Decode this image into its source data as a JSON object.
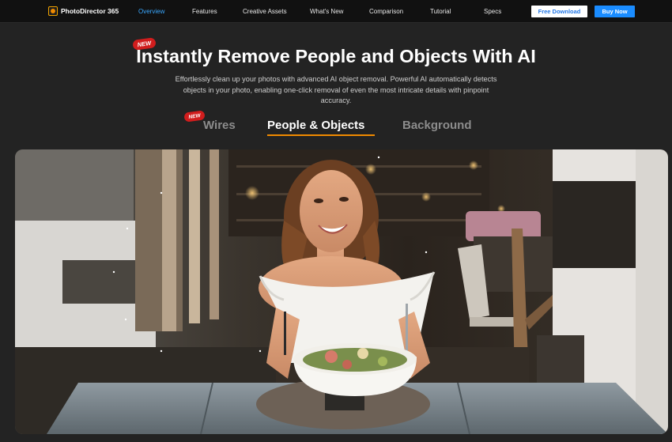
{
  "nav": {
    "brand": "PhotoDirector 365",
    "links": [
      {
        "label": "Overview",
        "active": true
      },
      {
        "label": "Features",
        "active": false
      },
      {
        "label": "Creative Assets",
        "active": false
      },
      {
        "label": "What's New",
        "active": false
      },
      {
        "label": "Comparison",
        "active": false
      },
      {
        "label": "Tutorial",
        "active": false
      },
      {
        "label": "Specs",
        "active": false
      }
    ],
    "free_download": "Free Download",
    "buy_now": "Buy Now"
  },
  "hero": {
    "badge": "NEW",
    "title": "Instantly Remove People and Objects With AI",
    "description": "Effortlessly clean up your photos with advanced AI object removal. Powerful AI automatically detects objects in your photo, enabling one-click removal of even the most intricate details with pinpoint accuracy."
  },
  "tabs": {
    "badge": "NEW",
    "items": [
      {
        "label": "Wires",
        "active": false
      },
      {
        "label": "People & Objects",
        "active": true
      },
      {
        "label": "Background",
        "active": false
      }
    ]
  },
  "colors": {
    "accent": "#f08a00",
    "nav_active": "#3aa8ff",
    "buy_button": "#1a8cff",
    "badge": "#d11d1d"
  }
}
